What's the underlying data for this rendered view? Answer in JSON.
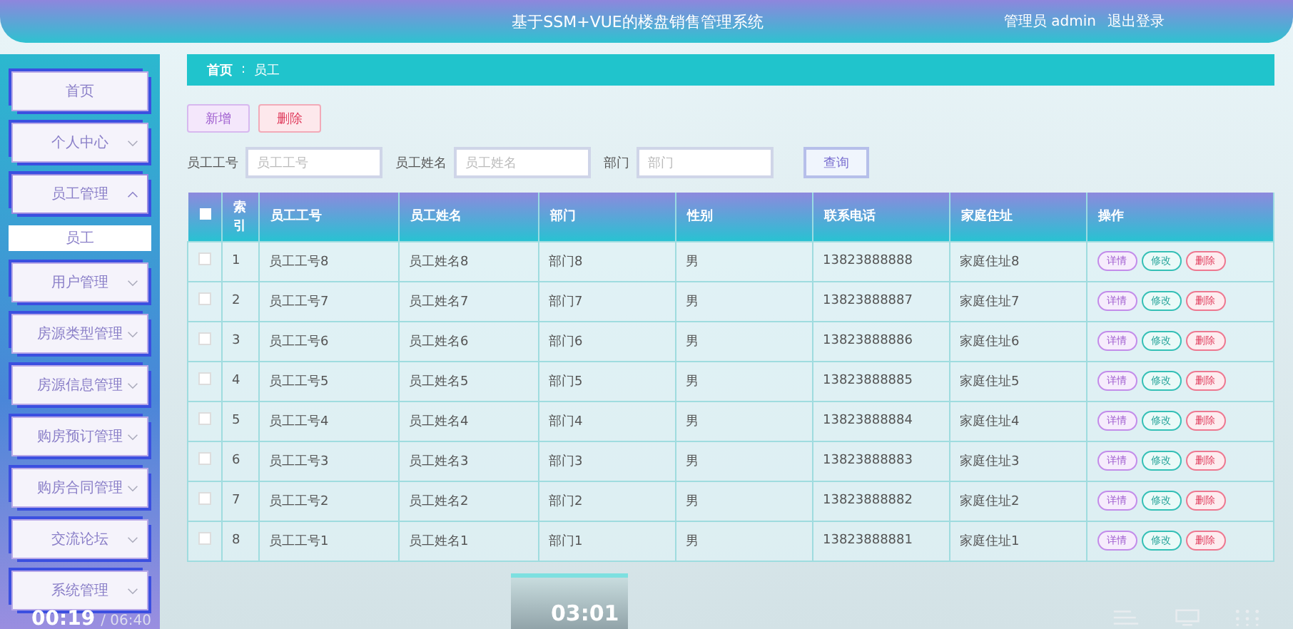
{
  "header": {
    "title": "基于SSM+VUE的楼盘销售管理系统",
    "user": "管理员 admin",
    "logout": "退出登录"
  },
  "sidebar": {
    "items": [
      {
        "label": "首页",
        "kind": "link"
      },
      {
        "label": "个人中心",
        "kind": "menu",
        "expanded": false
      },
      {
        "label": "员工管理",
        "kind": "menu",
        "expanded": true,
        "children": [
          {
            "label": "员工",
            "selected": true
          }
        ]
      },
      {
        "label": "用户管理",
        "kind": "menu",
        "expanded": false
      },
      {
        "label": "房源类型管理",
        "kind": "menu",
        "expanded": false
      },
      {
        "label": "房源信息管理",
        "kind": "menu",
        "expanded": false
      },
      {
        "label": "购房预订管理",
        "kind": "menu",
        "expanded": false
      },
      {
        "label": "购房合同管理",
        "kind": "menu",
        "expanded": false
      },
      {
        "label": "交流论坛",
        "kind": "menu",
        "expanded": false
      },
      {
        "label": "系统管理",
        "kind": "menu",
        "expanded": false
      }
    ]
  },
  "breadcrumb": {
    "home": "首页",
    "separator": ":",
    "current": "员工"
  },
  "toolbar": {
    "add": "新增",
    "delete": "删除"
  },
  "search": {
    "fields": [
      {
        "label": "员工工号",
        "placeholder": "员工工号"
      },
      {
        "label": "员工姓名",
        "placeholder": "员工姓名"
      },
      {
        "label": "部门",
        "placeholder": "部门"
      }
    ],
    "button": "查询"
  },
  "table": {
    "select_all_checked": false,
    "columns": [
      "索引",
      "员工工号",
      "员工姓名",
      "部门",
      "性别",
      "联系电话",
      "家庭住址",
      "操作"
    ],
    "rows": [
      {
        "checked": false,
        "cells": [
          "1",
          "员工工号8",
          "员工姓名8",
          "部门8",
          "男",
          "13823888888",
          "家庭住址8"
        ],
        "actions": [
          {
            "kind": "detail",
            "label": "详情"
          },
          {
            "kind": "edit",
            "label": "修改"
          },
          {
            "kind": "delete",
            "label": "删除"
          }
        ]
      },
      {
        "checked": false,
        "cells": [
          "2",
          "员工工号7",
          "员工姓名7",
          "部门7",
          "男",
          "13823888887",
          "家庭住址7"
        ],
        "actions": [
          {
            "kind": "detail",
            "label": "详情"
          },
          {
            "kind": "edit",
            "label": "修改"
          },
          {
            "kind": "delete",
            "label": "删除"
          }
        ]
      },
      {
        "checked": false,
        "cells": [
          "3",
          "员工工号6",
          "员工姓名6",
          "部门6",
          "男",
          "13823888886",
          "家庭住址6"
        ],
        "actions": [
          {
            "kind": "detail",
            "label": "详情"
          },
          {
            "kind": "edit",
            "label": "修改"
          },
          {
            "kind": "delete",
            "label": "删除"
          }
        ]
      },
      {
        "checked": false,
        "cells": [
          "4",
          "员工工号5",
          "员工姓名5",
          "部门5",
          "男",
          "13823888885",
          "家庭住址5"
        ],
        "actions": [
          {
            "kind": "detail",
            "label": "详情"
          },
          {
            "kind": "edit",
            "label": "修改"
          },
          {
            "kind": "delete",
            "label": "删除"
          }
        ]
      },
      {
        "checked": false,
        "cells": [
          "5",
          "员工工号4",
          "员工姓名4",
          "部门4",
          "男",
          "13823888884",
          "家庭住址4"
        ],
        "actions": [
          {
            "kind": "detail",
            "label": "详情"
          },
          {
            "kind": "edit",
            "label": "修改"
          },
          {
            "kind": "delete",
            "label": "删除"
          }
        ]
      },
      {
        "checked": false,
        "cells": [
          "6",
          "员工工号3",
          "员工姓名3",
          "部门3",
          "男",
          "13823888883",
          "家庭住址3"
        ],
        "actions": [
          {
            "kind": "detail",
            "label": "详情"
          },
          {
            "kind": "edit",
            "label": "修改"
          },
          {
            "kind": "delete",
            "label": "删除"
          }
        ]
      },
      {
        "checked": false,
        "cells": [
          "7",
          "员工工号2",
          "员工姓名2",
          "部门2",
          "男",
          "13823888882",
          "家庭住址2"
        ],
        "actions": [
          {
            "kind": "detail",
            "label": "详情"
          },
          {
            "kind": "edit",
            "label": "修改"
          },
          {
            "kind": "delete",
            "label": "删除"
          }
        ]
      },
      {
        "checked": false,
        "cells": [
          "8",
          "员工工号1",
          "员工姓名1",
          "部门1",
          "男",
          "13823888881",
          "家庭住址1"
        ],
        "actions": [
          {
            "kind": "detail",
            "label": "详情"
          },
          {
            "kind": "edit",
            "label": "修改"
          },
          {
            "kind": "delete",
            "label": "删除"
          }
        ]
      }
    ]
  },
  "video_player": {
    "elapsed": "00:19",
    "duration": "/ 06:40",
    "preview_time": "03:01"
  }
}
